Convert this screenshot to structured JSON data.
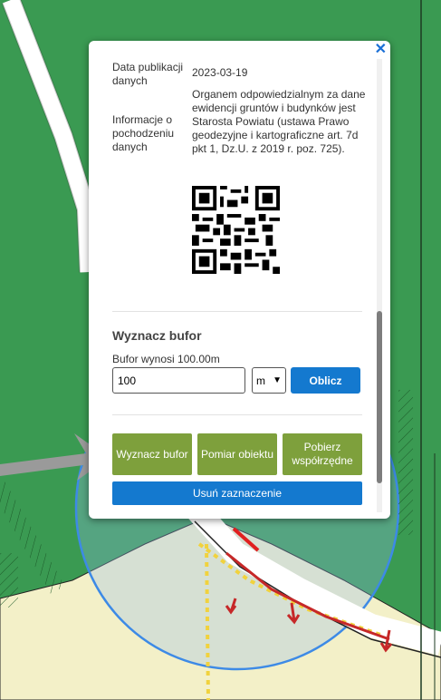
{
  "colors": {
    "map_green": "#3a9a52",
    "accent_blue": "#1479cf",
    "button_green": "#7ea03c"
  },
  "popup": {
    "close_icon": "close-icon",
    "publication_label": "Data publikacji danych",
    "publication_value": "2023-03-19",
    "origin_label": "Informacje o pochodzeniu danych",
    "origin_value": "Organem odpowiedzialnym za dane ewidencji gruntów i budynków jest Starosta Powiatu (ustawa Prawo geodezyjne i kartograficzne art. 7d pkt 1, Dz.U. z 2019 r. poz. 725)."
  },
  "buffer": {
    "heading": "Wyznacz bufor",
    "info": "Bufor wynosi 100.00m",
    "input_value": "100",
    "unit_value": "m",
    "compute_label": "Oblicz"
  },
  "actions": {
    "buffer_label": "Wyznacz bufor",
    "measure_label": "Pomiar obiektu",
    "coords_label": "Pobierz współrzędne",
    "clear_label": "Usuń zaznaczenie"
  }
}
